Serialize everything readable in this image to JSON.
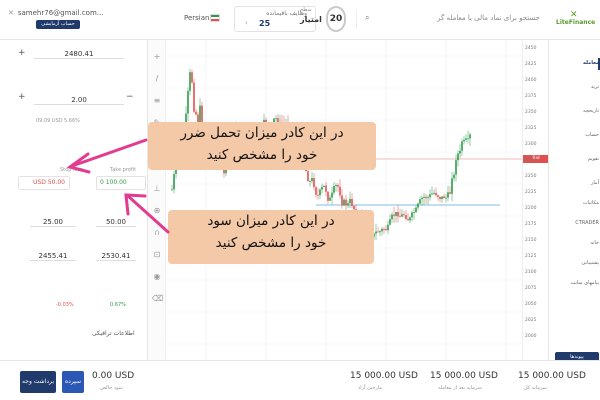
{
  "header": {
    "account_email": "samehr76@gmail.com...",
    "account_button": "حساب آزمایشی",
    "language": "Persian",
    "tasks_label": "وظایف باقیمانده",
    "tasks_count": "25",
    "level_label": "سطح",
    "score_label": "امتیاز",
    "level_value": "20",
    "search_placeholder": "جستجو برای نماد مالی یا معامله گر",
    "logo_text": "LiteFinance"
  },
  "order_panel": {
    "volume_value": "2480.41",
    "quantity_value": "2.00",
    "stop_loss_label": "Stop loss",
    "take_profit_label": "Take profit",
    "stop_loss_value": "USD 50.00",
    "take_profit_value": "0 100.00",
    "left_amount": "25.00",
    "right_amount": "50.00",
    "left_price": "2455.41",
    "right_price": "2530.41",
    "left_percent": "-0.03%",
    "right_percent": "0.67%",
    "small_1": "09.09 USD",
    "small_2": "5.66%",
    "market_info": "اطلاعات ترافیکی"
  },
  "callouts": {
    "stop_loss_line1": "در این کادر میزان تحمل ضرر",
    "stop_loss_line2": "خود را مشخص کنید",
    "take_profit_line1": "در این کادر میزان سود",
    "take_profit_line2": "خود را مشخص کنید"
  },
  "price_axis": {
    "labels": [
      "2450",
      "2425",
      "2400",
      "2375",
      "2350",
      "2325",
      "2300",
      "2275",
      "2250",
      "2225",
      "2200",
      "2175",
      "2150",
      "2125",
      "2100",
      "2075",
      "2050",
      "2025",
      "2000"
    ],
    "current_tag": "Bid 2480.25"
  },
  "right_nav": {
    "items": [
      "معامله",
      "ترید",
      "تاریخچه",
      "حساب",
      "تقویم",
      "آمار",
      "مکاتبات",
      "CTRADER",
      "خانه",
      "پشتیبانی",
      "پیامهای سایت"
    ],
    "notifications": "پیوندها"
  },
  "bottom": {
    "withdraw_button": "برداشت وجه",
    "deposit_button": "سپرده",
    "balance_value": "0.00 USD",
    "balance_label": "سود خالص",
    "free_value": "15 000.00 USD",
    "free_label": "مارجین آزاد",
    "equity_value": "15 000.00 USD",
    "equity_label": "سرمایه بعد از معامله",
    "total_value": "15 000.00 USD",
    "total_label": "سرمایه کل"
  },
  "colors": {
    "brand": "#1f3a6b",
    "callout": "#f4c9a8",
    "arrow": "#e23b8f",
    "candle_up": "#2e9a4a",
    "candle_down": "#e05050"
  }
}
